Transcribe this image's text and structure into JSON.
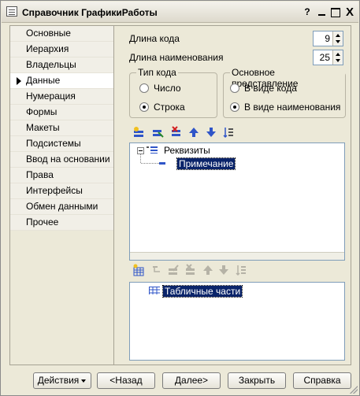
{
  "window": {
    "title": "Справочник ГрафикиРаботы",
    "help_glyph": "?",
    "close_glyph": "X"
  },
  "nav": {
    "items": [
      {
        "label": "Основные",
        "active": false
      },
      {
        "label": "Иерархия",
        "active": false
      },
      {
        "label": "Владельцы",
        "active": false
      },
      {
        "label": "Данные",
        "active": true
      },
      {
        "label": "Нумерация",
        "active": false
      },
      {
        "label": "Формы",
        "active": false
      },
      {
        "label": "Макеты",
        "active": false
      },
      {
        "label": "Подсистемы",
        "active": false
      },
      {
        "label": "Ввод на основании",
        "active": false
      },
      {
        "label": "Права",
        "active": false
      },
      {
        "label": "Интерфейсы",
        "active": false
      },
      {
        "label": "Обмен данными",
        "active": false
      },
      {
        "label": "Прочее",
        "active": false
      }
    ]
  },
  "fields": {
    "code_length_label": "Длина кода",
    "code_length_value": "9",
    "name_length_label": "Длина наименования",
    "name_length_value": "25"
  },
  "code_type": {
    "title": "Тип кода",
    "options": [
      "Число",
      "Строка"
    ],
    "selected": "Строка"
  },
  "main_presentation": {
    "title": "Основное представление",
    "options": [
      "В виде кода",
      "В виде наименования"
    ],
    "selected": "В виде наименования"
  },
  "attributes_tree": {
    "root_label": "Реквизиты",
    "child_label": "Примечание"
  },
  "tabular_tree": {
    "root_label": "Табличные части"
  },
  "toolbar_icons": {
    "top": [
      "add-icon",
      "add-child-icon",
      "delete-icon",
      "move-up-icon",
      "move-down-icon",
      "sort-icon"
    ],
    "bottom": [
      "add-icon",
      "add-child-icon",
      "edit-icon",
      "delete-icon",
      "move-up-icon",
      "move-down-icon",
      "sort-icon"
    ]
  },
  "footer": {
    "actions_label": "Действия",
    "back_label": "<Назад",
    "next_label": "Далее>",
    "close_label": "Закрыть",
    "help_label": "Справка"
  },
  "colors": {
    "window_bg": "#ece9d8",
    "selection": "#0a246a",
    "icon_blue": "#2f55c8",
    "icon_red": "#d22020"
  }
}
